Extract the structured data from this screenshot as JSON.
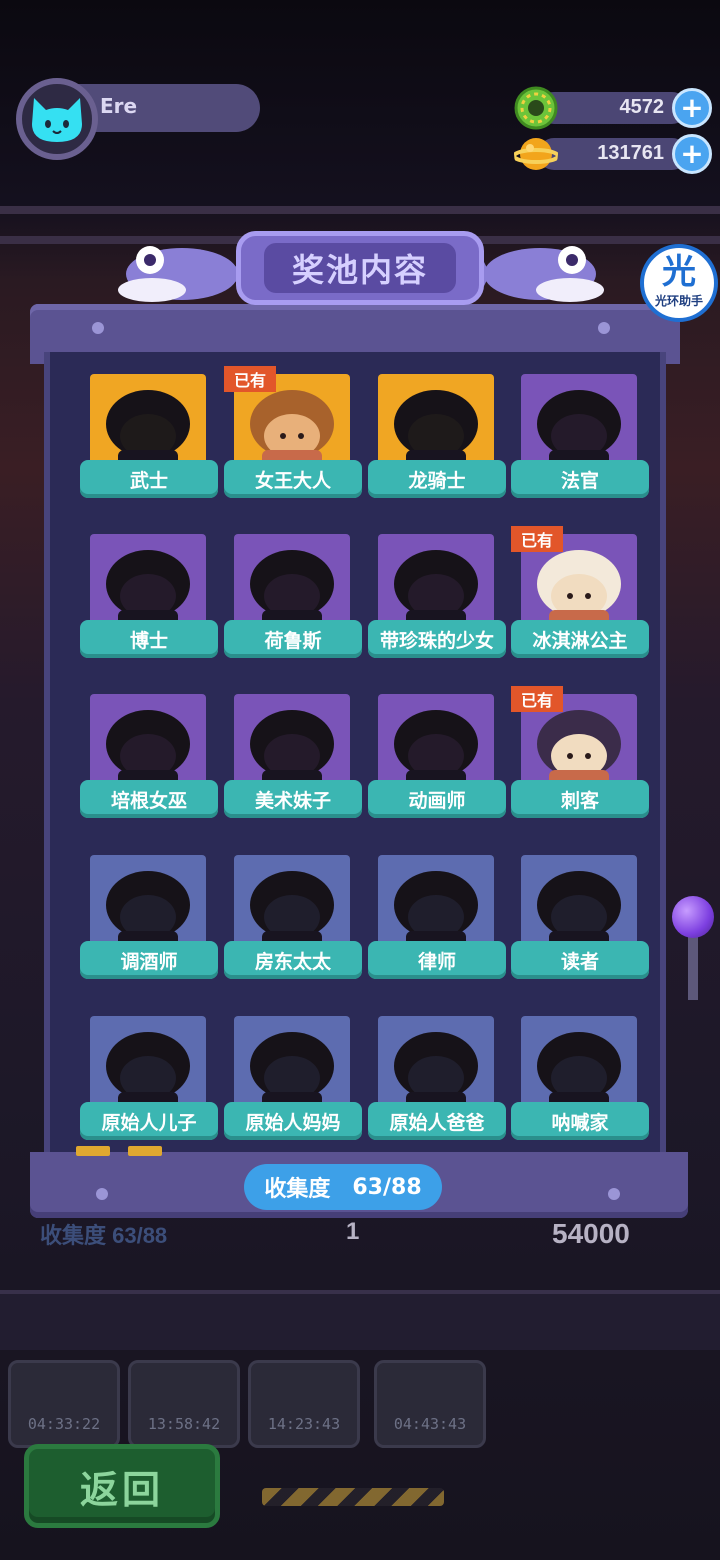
{
  "player": {
    "name": "Ere",
    "avatar_icon": "cat-face-icon"
  },
  "currencies": [
    {
      "icon": "green-donut-coin-icon",
      "value": "4572"
    },
    {
      "icon": "gold-planet-coin-icon",
      "value": "131761"
    }
  ],
  "helper": {
    "big": "光",
    "small": "光环助手"
  },
  "modal": {
    "title": "奖池内容",
    "collection_label": "收集度",
    "collection_value": "63/88",
    "owned_tag": "已有"
  },
  "characters": [
    {
      "name": "武士",
      "frame": "gold",
      "owned": false
    },
    {
      "name": "女王大人",
      "frame": "gold",
      "owned": true
    },
    {
      "name": "龙骑士",
      "frame": "gold",
      "owned": false
    },
    {
      "name": "法官",
      "frame": "purple",
      "owned": false
    },
    {
      "name": "博士",
      "frame": "purple",
      "owned": false
    },
    {
      "name": "荷鲁斯",
      "frame": "purple",
      "owned": false
    },
    {
      "name": "带珍珠的少女",
      "frame": "purple",
      "owned": false
    },
    {
      "name": "冰淇淋公主",
      "frame": "purple",
      "owned": true
    },
    {
      "name": "培根女巫",
      "frame": "purple",
      "owned": false
    },
    {
      "name": "美术妹子",
      "frame": "purple",
      "owned": false
    },
    {
      "name": "动画师",
      "frame": "purple",
      "owned": false
    },
    {
      "name": "刺客",
      "frame": "purple",
      "owned": true
    },
    {
      "name": "调酒师",
      "frame": "blue",
      "owned": false
    },
    {
      "name": "房东太太",
      "frame": "blue",
      "owned": false
    },
    {
      "name": "律师",
      "frame": "blue",
      "owned": false
    },
    {
      "name": "读者",
      "frame": "blue",
      "owned": false
    },
    {
      "name": "原始人儿子",
      "frame": "blue",
      "owned": false
    },
    {
      "name": "原始人妈妈",
      "frame": "blue",
      "owned": false
    },
    {
      "name": "原始人爸爸",
      "frame": "blue",
      "owned": false
    },
    {
      "name": "呐喊家",
      "frame": "blue",
      "owned": false
    }
  ],
  "background": {
    "collection_text": "收集度 63/88",
    "ticket_count": "1",
    "price": "54000",
    "back_label": "返回",
    "slot_timers": [
      "04:33:22",
      "13:58:42",
      "14:23:43",
      "04:43:43"
    ]
  },
  "colors": {
    "accent_blue": "#3da0e8",
    "label_teal": "#3bb6b2",
    "owned_tag": "#e2562a",
    "gold_frame": "#f0a623",
    "purple_frame": "#7a54b8",
    "blue_frame": "#5d6cb0"
  }
}
